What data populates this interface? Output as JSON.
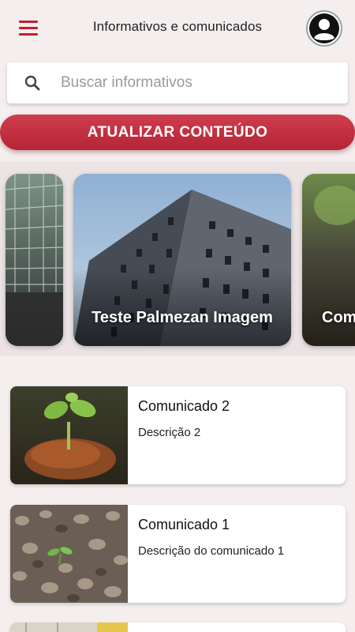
{
  "header": {
    "title": "Informativos e comunicados",
    "menu_icon": "hamburger-menu-icon",
    "profile_icon": "account-circle-icon"
  },
  "search": {
    "placeholder": "Buscar informativos",
    "value": "",
    "icon": "search-icon"
  },
  "refresh_button": {
    "label": "ATUALIZAR CONTEÚDO"
  },
  "carousel": {
    "items": [
      {
        "label": ""
      },
      {
        "label": "Teste Palmezan Imagem"
      },
      {
        "label": "Com"
      }
    ]
  },
  "communications": [
    {
      "title": "Comunicado 2",
      "description": "Descrição 2"
    },
    {
      "title": "Comunicado 1",
      "description": "Descrição do comunicado 1"
    }
  ],
  "colors": {
    "accent": "#c0202c",
    "background": "#f4eeee",
    "button": "#c8303f"
  }
}
